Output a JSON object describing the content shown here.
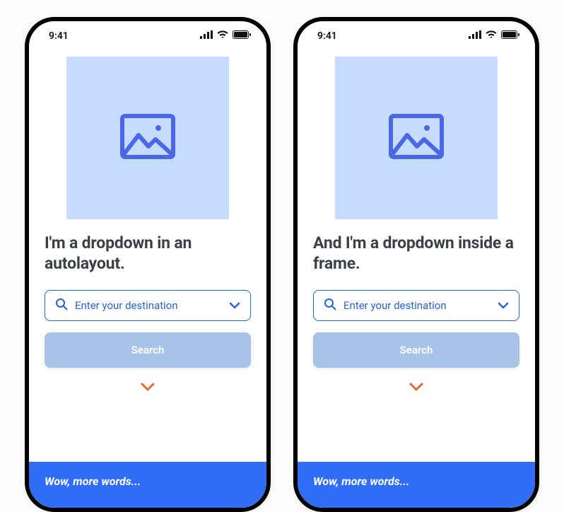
{
  "statusbar": {
    "time": "9:41"
  },
  "phones": [
    {
      "heading": "I'm a dropdown in an autolayout.",
      "dropdown_placeholder": "Enter your destination",
      "search_label": "Search",
      "footer_text": "Wow, more words..."
    },
    {
      "heading": "And I'm a dropdown inside a frame.",
      "dropdown_placeholder": "Enter your destination",
      "search_label": "Search",
      "footer_text": "Wow, more words..."
    }
  ]
}
